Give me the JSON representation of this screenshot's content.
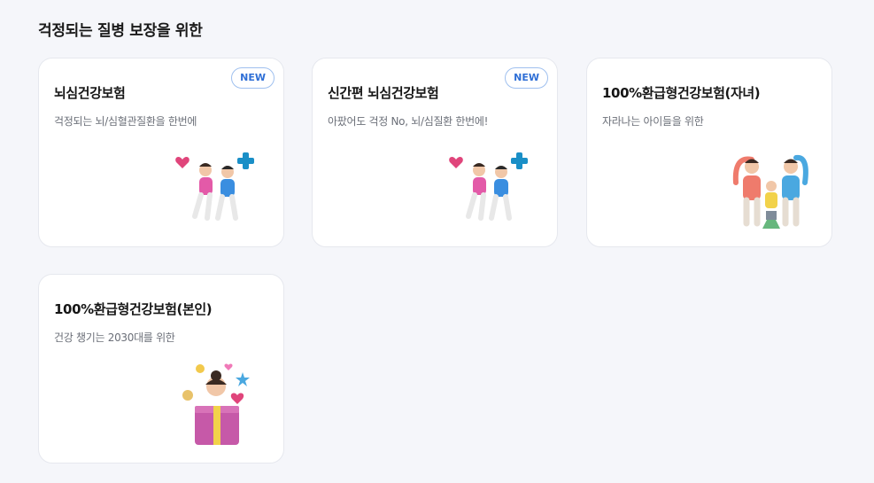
{
  "section": {
    "title": "걱정되는 질병 보장을 위한"
  },
  "cards": [
    {
      "title": "뇌심건강보험",
      "desc": "걱정되는 뇌/심혈관질환을 한번에",
      "badge": "NEW",
      "illustration": "running-couple-with-heart-and-cross"
    },
    {
      "title": "신간편 뇌심건강보험",
      "desc": "아팠어도 걱정 No, 뇌/심질환 한번에!",
      "badge": "NEW",
      "illustration": "running-couple-with-heart-and-cross"
    },
    {
      "title": "100%환급형건강보험(자녀)",
      "desc": "자라나는 아이들을 위한",
      "illustration": "family-with-child-and-house"
    },
    {
      "title": "100%환급형건강보험(본인)",
      "desc": "건강 챙기는 2030대를 위한",
      "illustration": "person-with-gift-box"
    }
  ],
  "colors": {
    "background": "#f5f6fa",
    "card": "#ffffff",
    "badge_text": "#2f6fd6",
    "badge_border": "#9fc0ef"
  }
}
